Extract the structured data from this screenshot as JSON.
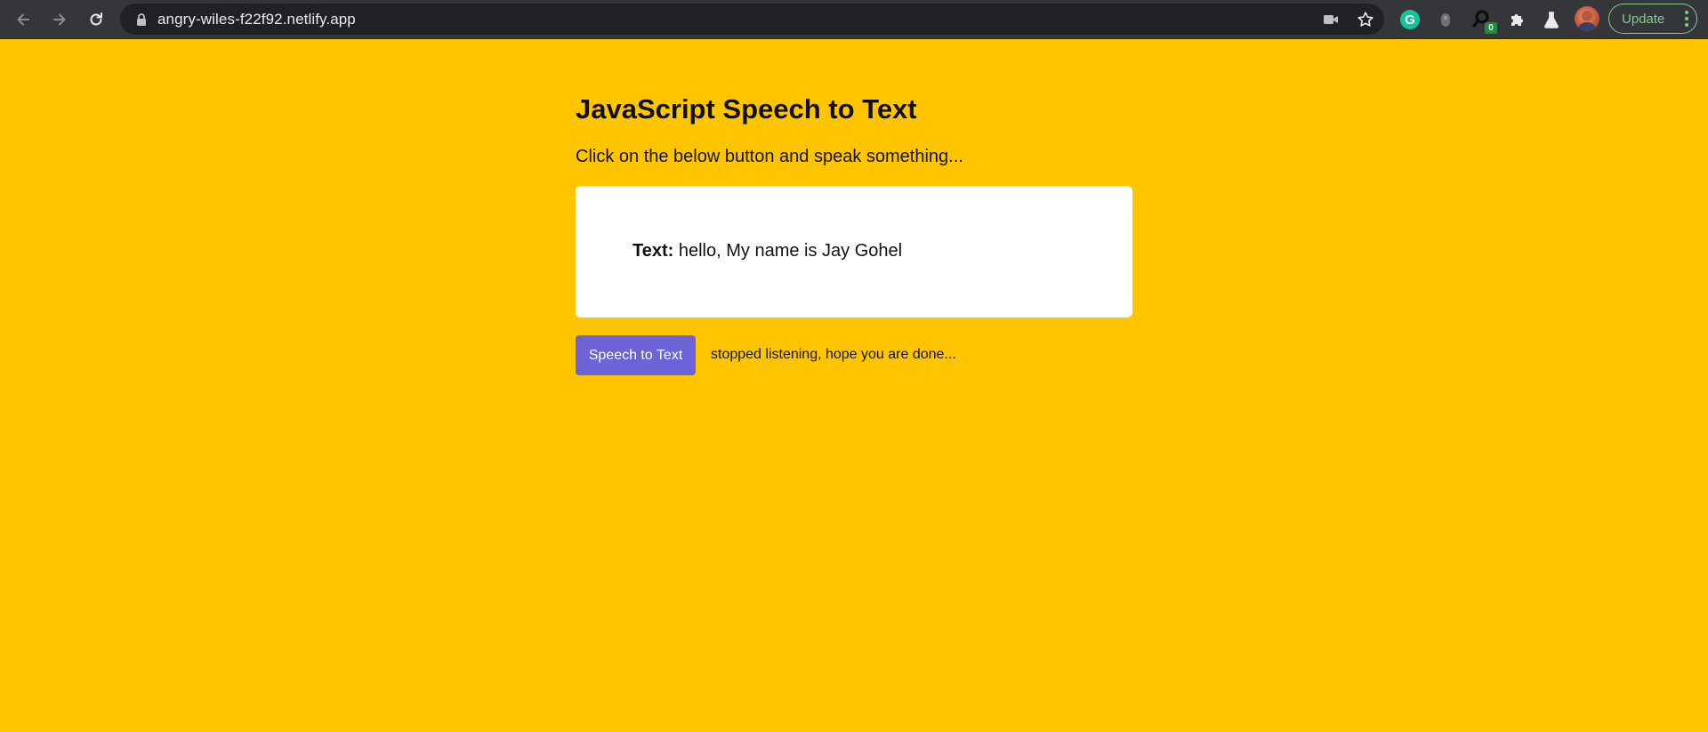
{
  "browser": {
    "url": "angry-wiles-f22f92.netlify.app",
    "update_label": "Update",
    "extension_badge": "0",
    "grammarly_letter": "G",
    "icons": [
      "back-icon",
      "forward-icon",
      "reload-icon",
      "lock-icon",
      "camera-icon",
      "star-icon",
      "grammarly-icon",
      "extension-icon",
      "search-extension-icon",
      "puzzle-icon",
      "flask-icon",
      "avatar",
      "menu-dots-icon"
    ],
    "colors": {
      "toolbar": "#35363a",
      "omnibox": "#202124",
      "update_accent": "#81c995"
    }
  },
  "page": {
    "title": "JavaScript Speech to Text",
    "subtitle": "Click on the below button and speak something...",
    "result_label": "Text:",
    "result_value": " hello, My name is Jay Gohel",
    "button_label": "Speech to Text",
    "status": "stopped listening, hope you are done...",
    "colors": {
      "background": "#ffc500",
      "card": "#ffffff",
      "button": "#6c63d6"
    }
  }
}
